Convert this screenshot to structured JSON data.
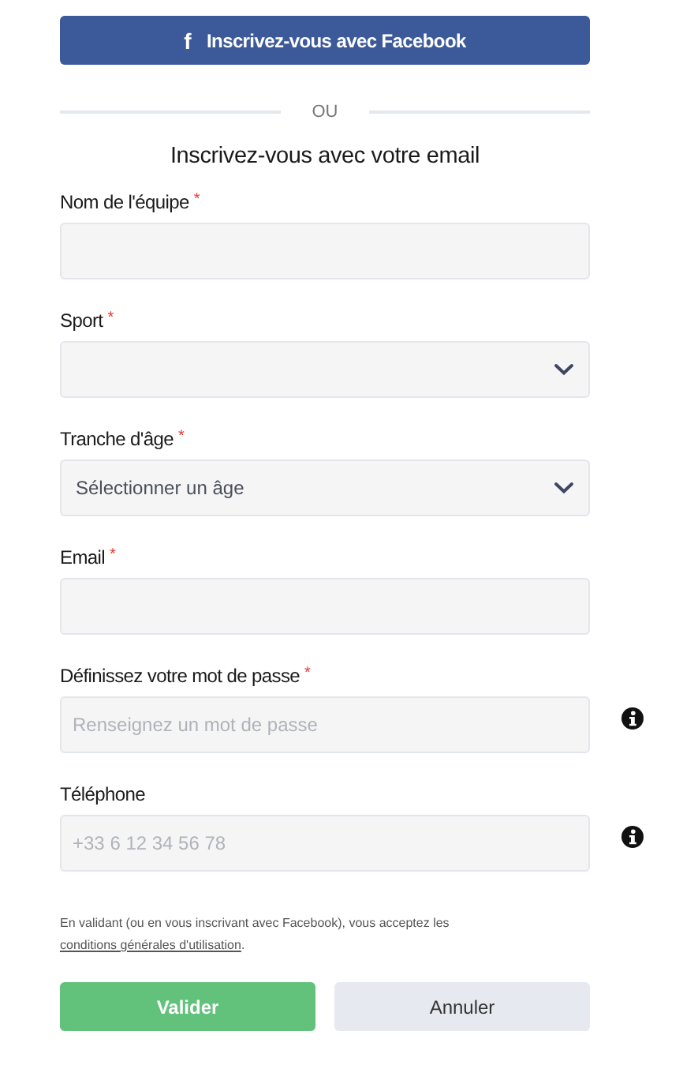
{
  "facebook_button": {
    "icon": "f",
    "label": "Inscrivez-vous avec Facebook"
  },
  "divider": "OU",
  "title": "Inscrivez-vous avec votre email",
  "fields": [
    {
      "kind": "text",
      "label": "Nom de l'équipe",
      "required_mark": "*",
      "info": false
    },
    {
      "kind": "select",
      "label": "Sport",
      "required_mark": "*",
      "info": false
    },
    {
      "kind": "select",
      "label": "Tranche d'âge",
      "required_mark": "*",
      "info": false,
      "value": "Sélectionner un âge"
    },
    {
      "kind": "text",
      "label": "Email",
      "required_mark": "*",
      "info": false
    },
    {
      "kind": "text",
      "label": "Définissez votre mot de passe",
      "required_mark": "*",
      "info": true,
      "placeholder": "Renseignez un mot de passe"
    },
    {
      "kind": "text",
      "label": "Téléphone",
      "info": true,
      "placeholder": "+33 6 12 34 56 78"
    }
  ],
  "consent": {
    "text": "En validant (ou en vous inscrivant avec Facebook), vous acceptez les ",
    "link": "conditions générales d'utilisation",
    "end": "."
  },
  "buttons": [
    {
      "kind": "primary",
      "label": "Valider"
    },
    {
      "kind": "secondary",
      "label": "Annuler"
    }
  ]
}
